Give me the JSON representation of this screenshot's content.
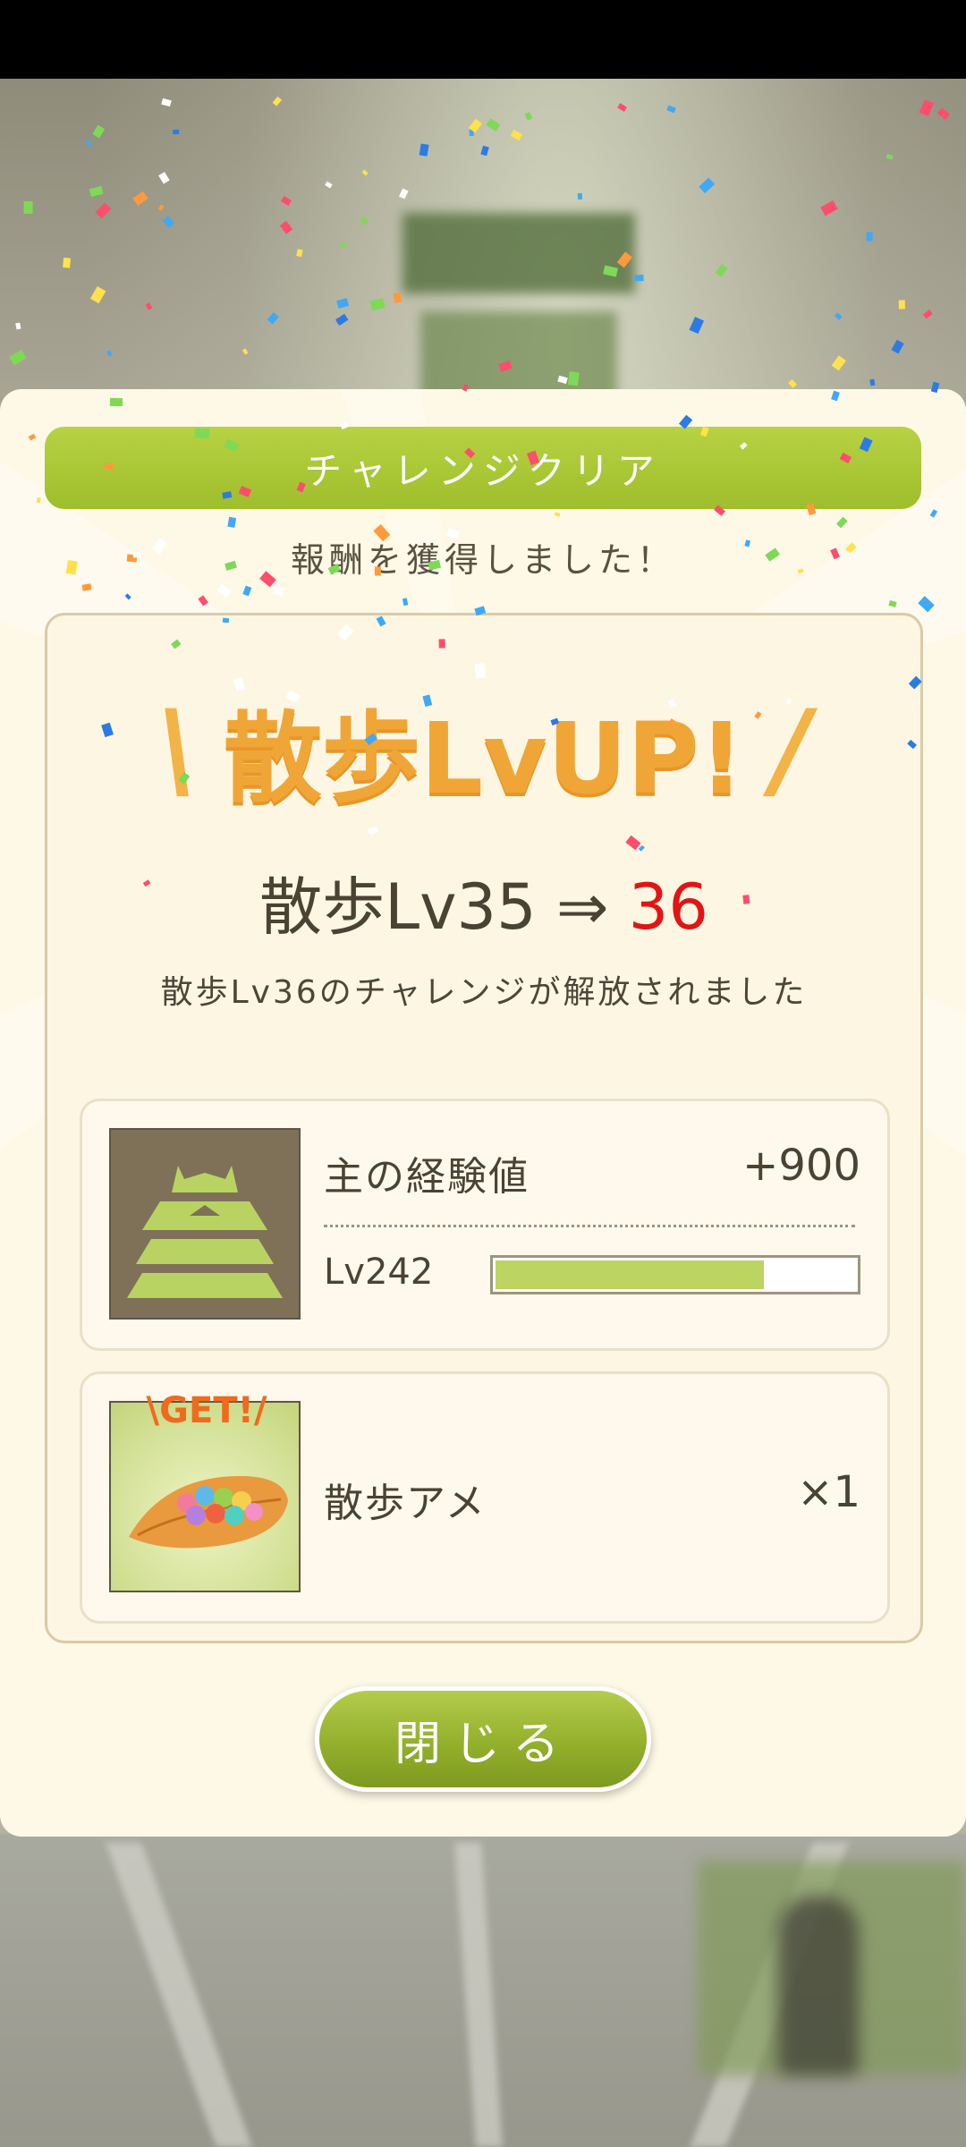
{
  "header": {
    "title": "チャレンジクリア",
    "reward_message": "報酬を獲得しました！"
  },
  "level_up": {
    "banner_left": "\\",
    "banner_text": "散歩LvUP!",
    "banner_right": "/",
    "from_text": "散歩Lv35 ⇒ ",
    "to_text": "36",
    "unlock_message": "散歩Lv36のチャレンジが解放されました"
  },
  "rewards": [
    {
      "icon": "castle-icon",
      "label": "主の経験値",
      "value": "+900",
      "level_label": "Lv242",
      "level_progress": 0.75
    },
    {
      "icon": "candy-leaf-icon",
      "badge": "\\GET!/",
      "label": "散歩アメ",
      "value": "×1"
    }
  ],
  "buttons": {
    "close": "閉じる"
  },
  "colors": {
    "accent_green": "#a8c637",
    "level_up_orange": "#f0a637",
    "new_level_red": "#e31414",
    "panel_cream": "#fef8e6"
  }
}
